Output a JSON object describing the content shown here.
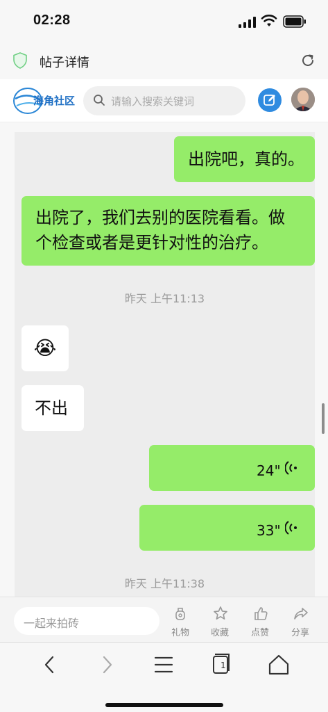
{
  "status_bar": {
    "time": "02:28"
  },
  "title_bar": {
    "title": "帖子详情"
  },
  "header": {
    "logo_text": "海角社区",
    "search_placeholder": "请输入搜索关键词"
  },
  "chat": {
    "messages": [
      {
        "side": "right",
        "type": "text",
        "text": "出院吧，真的。"
      },
      {
        "side": "right",
        "type": "text",
        "lines": [
          "出院了，我们去别的医院看看。做",
          "个检查或者是更针对性的治疗。"
        ]
      },
      {
        "type": "timestamp",
        "text": "昨天 上午11:13"
      },
      {
        "side": "left",
        "type": "emoji",
        "emoji": "😭"
      },
      {
        "side": "left",
        "type": "text",
        "text": "不出"
      },
      {
        "side": "right",
        "type": "voice",
        "duration": "24\""
      },
      {
        "side": "right",
        "type": "voice",
        "duration": "33\""
      },
      {
        "type": "timestamp",
        "text": "昨天 上午11:38"
      }
    ]
  },
  "comment_bar": {
    "placeholder": "一起来拍砖",
    "actions": [
      {
        "label": "礼物",
        "icon": "gift-icon"
      },
      {
        "label": "收藏",
        "icon": "star-icon"
      },
      {
        "label": "点赞",
        "icon": "thumbs-up-icon"
      },
      {
        "label": "分享",
        "icon": "share-icon"
      }
    ]
  },
  "browser_nav": {
    "tab_count": "1"
  },
  "colors": {
    "bubble_green": "#95ec69",
    "chat_background": "#ededed",
    "accent_blue": "#2f8be0"
  }
}
